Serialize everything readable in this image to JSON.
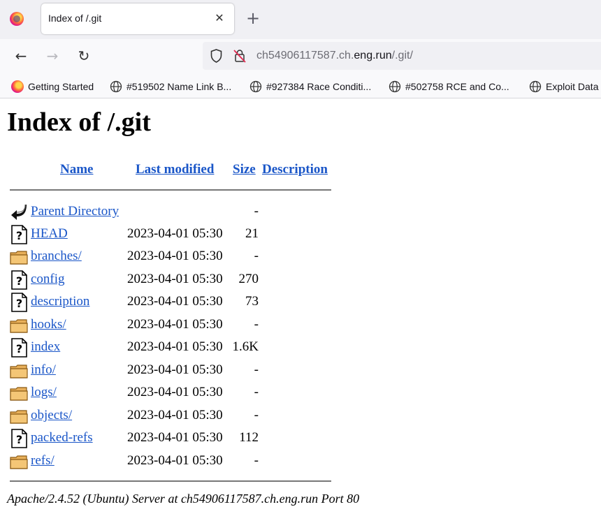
{
  "browser": {
    "tab_title": "Index of /.git",
    "tab_close_glyph": "✕",
    "new_tab_glyph": "+",
    "back_glyph": "←",
    "forward_glyph": "→",
    "reload_glyph": "↻",
    "url_prefix": "ch54906117587.ch.",
    "url_host": "eng.run",
    "url_path": "/.git/",
    "bookmarks": [
      {
        "label": "Getting Started",
        "icon": "firefox-icon"
      },
      {
        "label": "#519502 Name Link B...",
        "icon": "globe-icon"
      },
      {
        "label": "#927384 Race Conditi...",
        "icon": "globe-icon"
      },
      {
        "label": "#502758 RCE and Co...",
        "icon": "globe-icon"
      },
      {
        "label": "Exploit Data",
        "icon": "globe-icon"
      }
    ]
  },
  "page": {
    "title": "Index of /.git",
    "columns": {
      "name": "Name",
      "last_modified": "Last modified",
      "size": "Size",
      "description": "Description"
    },
    "entries": [
      {
        "name": "Parent Directory",
        "date": "",
        "size": "-",
        "icon": "back-arrow-icon"
      },
      {
        "name": "HEAD",
        "date": "2023-04-01 05:30",
        "size": "21",
        "icon": "unknown-file-icon"
      },
      {
        "name": "branches/",
        "date": "2023-04-01 05:30",
        "size": "-",
        "icon": "folder-icon"
      },
      {
        "name": "config",
        "date": "2023-04-01 05:30",
        "size": "270",
        "icon": "unknown-file-icon"
      },
      {
        "name": "description",
        "date": "2023-04-01 05:30",
        "size": "73",
        "icon": "unknown-file-icon"
      },
      {
        "name": "hooks/",
        "date": "2023-04-01 05:30",
        "size": "-",
        "icon": "folder-icon"
      },
      {
        "name": "index",
        "date": "2023-04-01 05:30",
        "size": "1.6K",
        "icon": "unknown-file-icon"
      },
      {
        "name": "info/",
        "date": "2023-04-01 05:30",
        "size": "-",
        "icon": "folder-icon"
      },
      {
        "name": "logs/",
        "date": "2023-04-01 05:30",
        "size": "-",
        "icon": "folder-icon"
      },
      {
        "name": "objects/",
        "date": "2023-04-01 05:30",
        "size": "-",
        "icon": "folder-icon"
      },
      {
        "name": "packed-refs",
        "date": "2023-04-01 05:30",
        "size": "112",
        "icon": "unknown-file-icon"
      },
      {
        "name": "refs/",
        "date": "2023-04-01 05:30",
        "size": "-",
        "icon": "folder-icon"
      }
    ],
    "footer": "Apache/2.4.52 (Ubuntu) Server at ch54906117587.ch.eng.run Port 80"
  }
}
